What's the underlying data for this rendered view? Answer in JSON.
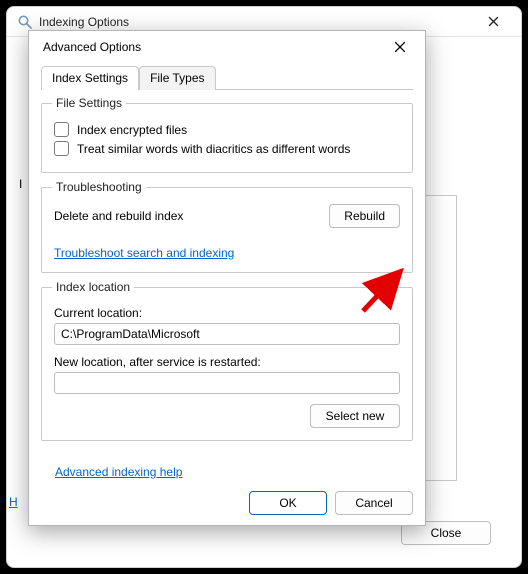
{
  "outer": {
    "title": "Indexing Options",
    "left_letter": "I",
    "help_link": "H",
    "close": "Close"
  },
  "dialog": {
    "title": "Advanced Options",
    "tabs": {
      "settings": "Index Settings",
      "filetypes": "File Types"
    },
    "file_settings": {
      "legend": "File Settings",
      "encrypted": "Index encrypted files",
      "diacritics": "Treat similar words with diacritics as different words"
    },
    "troubleshooting": {
      "legend": "Troubleshooting",
      "rebuild_label": "Delete and rebuild index",
      "rebuild_btn": "Rebuild",
      "ts_link": "Troubleshoot search and indexing"
    },
    "index_location": {
      "legend": "Index location",
      "current_label": "Current location:",
      "current_value": "C:\\ProgramData\\Microsoft",
      "new_label": "New location, after service is restarted:",
      "new_value": "",
      "select_new": "Select new"
    },
    "adv_link": "Advanced indexing help",
    "ok": "OK",
    "cancel": "Cancel"
  }
}
